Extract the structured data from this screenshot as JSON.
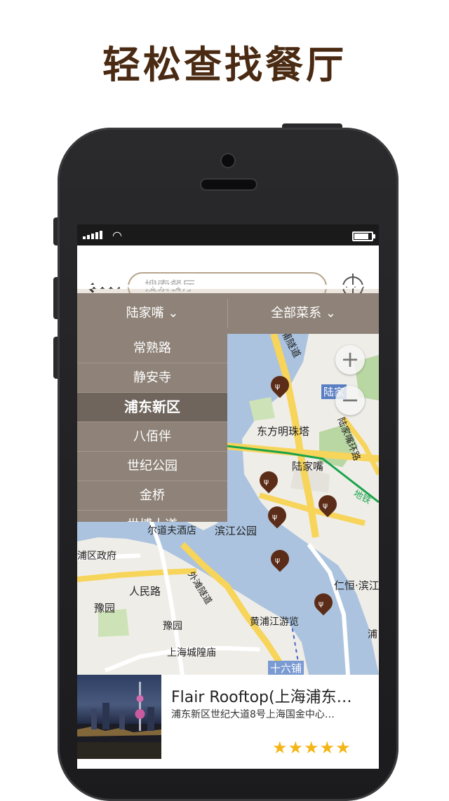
{
  "headline": "轻松查找餐厅",
  "search": {
    "placeholder": "搜索餐厅"
  },
  "filters": {
    "area": "陆家嘴",
    "cuisine": "全部菜系",
    "chevron": "⌄"
  },
  "dropdown": {
    "items": [
      "常熟路",
      "静安寺",
      "浦东新区",
      "八佰伴",
      "世纪公园",
      "金桥",
      "世博大道"
    ],
    "selected": "浦东新区"
  },
  "map": {
    "labels": {
      "l1": "浦隧道",
      "l2": "陆家",
      "l3": "东方明珠塔",
      "l4": "陆家嘴",
      "l5": "陆家嘴环路",
      "l6": "地铁",
      "l7": "尔道夫酒店",
      "l8": "滨江公园",
      "l9": "浦区政府",
      "l10": "人民路",
      "l11": "仁恒·滨江",
      "l12": "豫园",
      "l13": "豫园",
      "l14": "黄浦江游览",
      "l15": "外滩隧道",
      "l16": "上海城隍庙",
      "l17": "十六铺",
      "l18": "浦"
    },
    "zoom_in": "+",
    "zoom_out": "−",
    "pin_icon": "fork-knife"
  },
  "card": {
    "title": "Flair Rooftop(上海浦东…",
    "address": "浦东新区世纪大道8号上海国金中心…",
    "rating": 5,
    "stars": "★★★★★"
  },
  "colors": {
    "brand": "#4a2a12",
    "filterbar": "#8f8379",
    "pin": "#5b2c18",
    "star": "#f4b516"
  }
}
